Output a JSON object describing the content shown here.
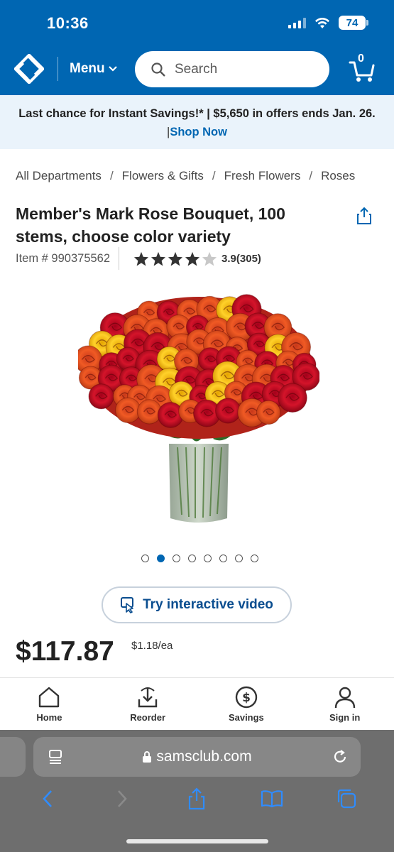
{
  "status_bar": {
    "time": "10:36",
    "battery": "74"
  },
  "header": {
    "menu_label": "Menu",
    "search_placeholder": "Search",
    "cart_count": "0"
  },
  "promo": {
    "text": "Last chance for Instant Savings!* | $5,650 in offers ends Jan. 26.",
    "sep": "|",
    "link": "Shop Now"
  },
  "breadcrumb": [
    "All Departments",
    "Flowers & Gifts",
    "Fresh Flowers",
    "Roses"
  ],
  "product": {
    "title": "Member's Mark Rose Bouquet, 100 stems, choose color variety",
    "item_number": "Item # 990375562",
    "rating": 3.9,
    "rating_text": "3.9(305)",
    "stars_filled": 4,
    "stars_total": 5,
    "image_count": 8,
    "active_image": 2,
    "video_button": "Try interactive video",
    "price": "$117.87",
    "unit_price": "$1.18/ea"
  },
  "bottom_nav": [
    {
      "label": "Home",
      "icon": "home-icon"
    },
    {
      "label": "Reorder",
      "icon": "reorder-icon"
    },
    {
      "label": "Savings",
      "icon": "savings-icon"
    },
    {
      "label": "Sign in",
      "icon": "user-icon"
    }
  ],
  "browser": {
    "url": "samsclub.com"
  },
  "colors": {
    "brand_blue": "#0066b2",
    "promo_bg": "#eaf3fb",
    "star": "#333333",
    "star_empty": "#c8c8c8"
  }
}
